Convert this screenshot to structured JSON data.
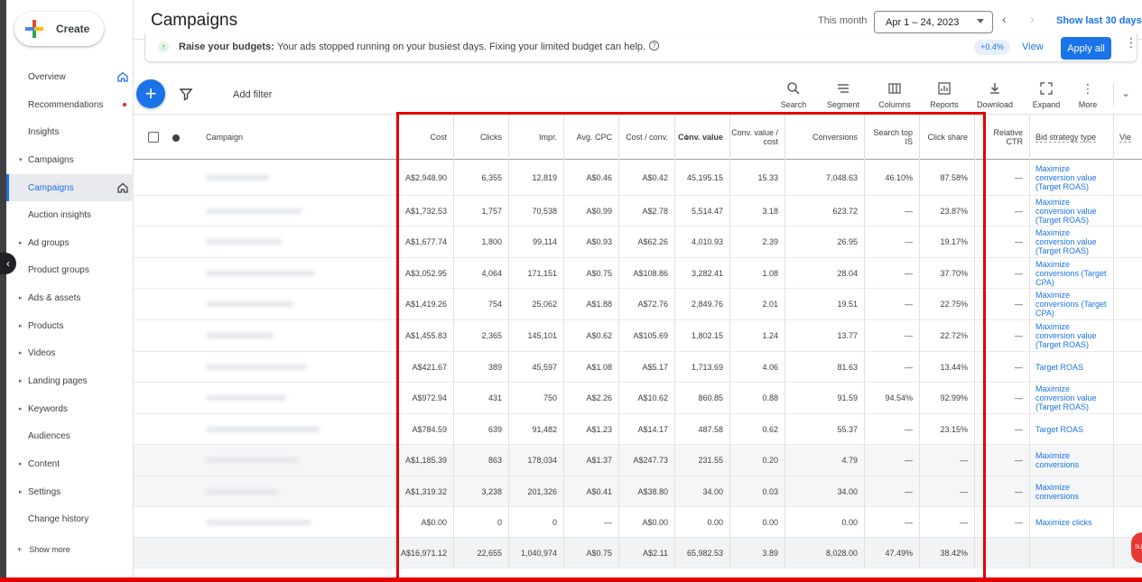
{
  "sidebar": {
    "create_label": "Create",
    "items": [
      {
        "label": "Overview",
        "caret": false,
        "home": true,
        "active": false
      },
      {
        "label": "Recommendations",
        "caret": false,
        "dot": true,
        "active": false
      },
      {
        "label": "Insights",
        "caret": false,
        "active": false
      },
      {
        "label": "Campaigns",
        "caret": true,
        "expanded": true,
        "active": false
      },
      {
        "label": "Campaigns",
        "caret": false,
        "home": true,
        "active": true
      },
      {
        "label": "Auction insights",
        "caret": false,
        "active": false
      },
      {
        "label": "Ad groups",
        "caret": true,
        "active": false
      },
      {
        "label": "Product groups",
        "caret": false,
        "active": false
      },
      {
        "label": "Ads & assets",
        "caret": true,
        "active": false
      },
      {
        "label": "Products",
        "caret": true,
        "active": false
      },
      {
        "label": "Videos",
        "caret": true,
        "active": false
      },
      {
        "label": "Landing pages",
        "caret": true,
        "active": false
      },
      {
        "label": "Keywords",
        "caret": true,
        "active": false
      },
      {
        "label": "Audiences",
        "caret": false,
        "active": false
      },
      {
        "label": "Content",
        "caret": true,
        "active": false
      },
      {
        "label": "Settings",
        "caret": true,
        "active": false
      },
      {
        "label": "Change history",
        "caret": false,
        "active": false
      }
    ],
    "show_more": "Show more"
  },
  "header": {
    "title": "Campaigns",
    "this_month": "This month",
    "date_range": "Apr 1 – 24, 2023",
    "show_last": "Show last 30 days"
  },
  "recommendation": {
    "title": "Raise your budgets:",
    "text": "Your ads stopped running on your busiest days. Fixing your limited budget can help.",
    "uplift": "+0.4%",
    "view": "View",
    "apply_all": "Apply all"
  },
  "toolbar": {
    "add_filter": "Add filter",
    "tools": [
      "Search",
      "Segment",
      "Columns",
      "Reports",
      "Download",
      "Expand",
      "More"
    ]
  },
  "table": {
    "campaign_header": "Campaign",
    "columns": [
      "Cost",
      "Clicks",
      "Impr.",
      "Avg. CPC",
      "Cost / conv.",
      "Conv. value",
      "Conv. value / cost",
      "Conversions",
      "Search top IS",
      "Click share",
      "Relative CTR",
      "Bid strategy type",
      "Vie"
    ],
    "rows": [
      [
        "A$2,948.90",
        "6,355",
        "12,819",
        "A$0.46",
        "A$0.42",
        "45,195.15",
        "15.33",
        "7,048.63",
        "46.10%",
        "87.58%",
        "—",
        "Maximize conversion value (Target ROAS)"
      ],
      [
        "A$1,732.53",
        "1,757",
        "70,538",
        "A$0.99",
        "A$2.78",
        "5,514.47",
        "3.18",
        "623.72",
        "—",
        "23.87%",
        "—",
        "Maximize conversion value (Target ROAS)"
      ],
      [
        "A$1,677.74",
        "1,800",
        "99,114",
        "A$0.93",
        "A$62.26",
        "4,010.93",
        "2.39",
        "26.95",
        "—",
        "19.17%",
        "—",
        "Maximize conversion value (Target ROAS)"
      ],
      [
        "A$3,052.95",
        "4,064",
        "171,151",
        "A$0.75",
        "A$108.86",
        "3,282.41",
        "1.08",
        "28.04",
        "—",
        "37.70%",
        "—",
        "Maximize conversions (Target CPA)"
      ],
      [
        "A$1,419.26",
        "754",
        "25,062",
        "A$1.88",
        "A$72.76",
        "2,849.76",
        "2.01",
        "19.51",
        "—",
        "22.75%",
        "—",
        "Maximize conversions (Target CPA)"
      ],
      [
        "A$1,455.83",
        "2,365",
        "145,101",
        "A$0.62",
        "A$105.69",
        "1,802.15",
        "1.24",
        "13.77",
        "—",
        "22.72%",
        "—",
        "Maximize conversion value (Target ROAS)"
      ],
      [
        "A$421.67",
        "389",
        "45,597",
        "A$1.08",
        "A$5.17",
        "1,713.69",
        "4.06",
        "81.63",
        "—",
        "13.44%",
        "—",
        "Target ROAS"
      ],
      [
        "A$972.94",
        "431",
        "750",
        "A$2.26",
        "A$10.62",
        "860.85",
        "0.88",
        "91.59",
        "94.54%",
        "92.99%",
        "—",
        "Maximize conversion value (Target ROAS)"
      ],
      [
        "A$784.59",
        "639",
        "91,482",
        "A$1.23",
        "A$14.17",
        "487.58",
        "0.62",
        "55.37",
        "—",
        "23.15%",
        "—",
        "Target ROAS"
      ],
      [
        "A$1,185.39",
        "863",
        "178,034",
        "A$1.37",
        "A$247.73",
        "231.55",
        "0.20",
        "4.79",
        "—",
        "—",
        "—",
        "Maximize conversions"
      ],
      [
        "A$1,319.32",
        "3,238",
        "201,326",
        "A$0.41",
        "A$38.80",
        "34.00",
        "0.03",
        "34.00",
        "—",
        "—",
        "—",
        "Maximize conversions"
      ],
      [
        "A$0.00",
        "0",
        "0",
        "—",
        "A$0.00",
        "0.00",
        "0.00",
        "0.00",
        "—",
        "—",
        "—",
        "Maximize clicks"
      ]
    ],
    "total": [
      "A$16,971.12",
      "22,655",
      "1,040,974",
      "A$0.75",
      "A$2.11",
      "65,982.53",
      "3.89",
      "8,028.00",
      "47.49%",
      "38.42%",
      "",
      ""
    ]
  },
  "colors": {
    "accent": "#1a73e8",
    "highlight_box": "#e50000"
  }
}
